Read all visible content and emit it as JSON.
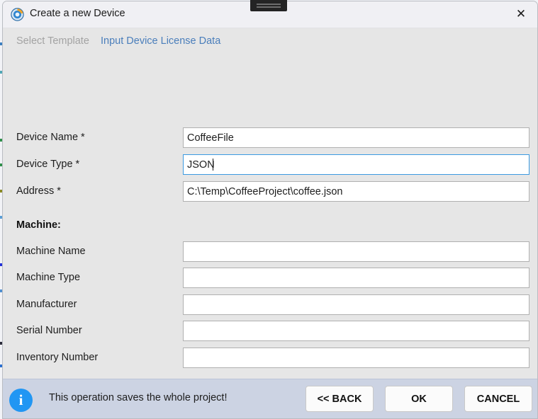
{
  "window": {
    "title": "Create a new Device",
    "app_icon": "app-logo-icon",
    "close_glyph": "✕",
    "snap_handle": "window-drag-handle"
  },
  "tabs": [
    {
      "label": "Select Template",
      "state": "inactive"
    },
    {
      "label": "Input Device License Data",
      "state": "active"
    }
  ],
  "form": {
    "device_fields": [
      {
        "label": "Device Name *",
        "value": "CoffeeFile",
        "placeholder": "",
        "focused": false
      },
      {
        "label": "Device Type *",
        "value": "JSON",
        "placeholder": "",
        "focused": true
      },
      {
        "label": "Address *",
        "value": "C:\\Temp\\CoffeeProject\\coffee.json",
        "placeholder": "",
        "focused": false
      }
    ],
    "machine_section_label": "Machine:",
    "machine_fields": [
      {
        "label": "Machine Name",
        "value": "",
        "placeholder": "",
        "focused": false
      },
      {
        "label": "Machine Type",
        "value": "",
        "placeholder": "",
        "focused": false
      },
      {
        "label": "Manufacturer",
        "value": "",
        "placeholder": "",
        "focused": false
      },
      {
        "label": "Serial Number",
        "value": "",
        "placeholder": "",
        "focused": false
      },
      {
        "label": "Inventory Number",
        "value": "",
        "placeholder": "",
        "focused": false
      }
    ]
  },
  "footer": {
    "info_icon": "info-icon",
    "message": "This operation saves the whole project!",
    "buttons": [
      {
        "label": "<< BACK",
        "name": "back-button"
      },
      {
        "label": "OK",
        "name": "ok-button"
      },
      {
        "label": "CANCEL",
        "name": "cancel-button"
      }
    ]
  },
  "colors": {
    "accent_blue": "#4a7ebb",
    "focus_border": "#3b9ae1",
    "info_blue": "#2196f3",
    "footer_bg": "#ccd3e3",
    "dialog_bg": "#e6e6e6",
    "titlebar_bg": "#f0f0f4",
    "disabled_text": "#a3a3a3"
  }
}
